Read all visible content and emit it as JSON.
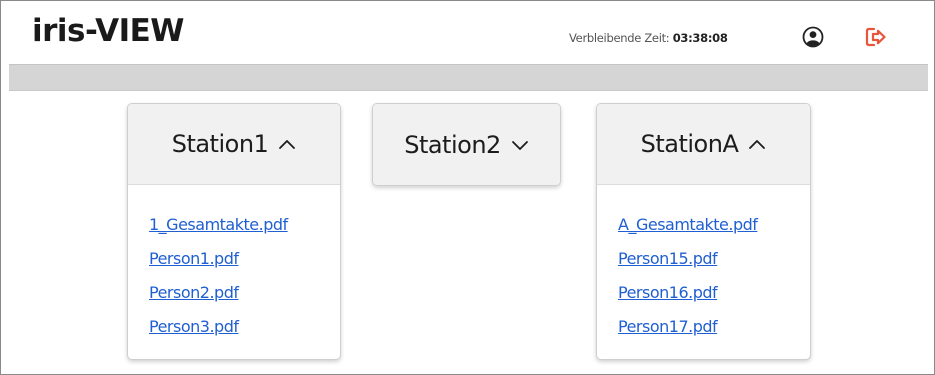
{
  "app": {
    "title": "iris-VIEW"
  },
  "header": {
    "timer_label": "Verbleibende Zeit:",
    "timer_value": "03:38:08",
    "user_icon": "user-circle-icon",
    "logout_icon": "logout-icon",
    "logout_color": "#e8553a"
  },
  "stations": [
    {
      "name": "Station1",
      "state": "expanded",
      "files": [
        "1_Gesamtakte.pdf",
        "Person1.pdf",
        "Person2.pdf",
        "Person3.pdf"
      ]
    },
    {
      "name": "Station2",
      "state": "collapsed",
      "files": []
    },
    {
      "name": "StationA",
      "state": "expanded",
      "files": [
        "A_Gesamtakte.pdf",
        "Person15.pdf",
        "Person16.pdf",
        "Person17.pdf"
      ]
    }
  ],
  "colors": {
    "link": "#1f5fd1",
    "bar": "#d5d5d5",
    "card_header": "#f1f1f1"
  }
}
